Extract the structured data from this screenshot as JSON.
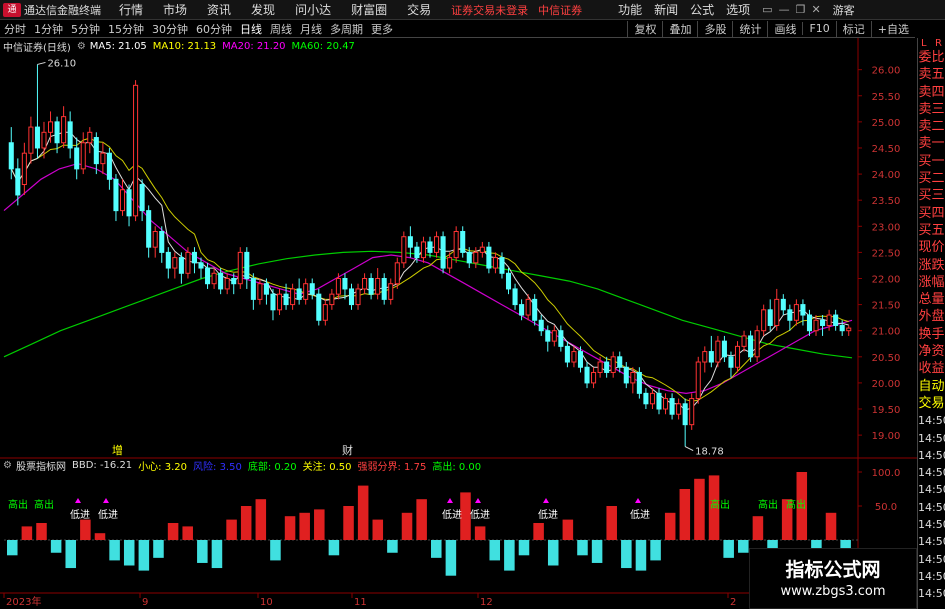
{
  "menubar": {
    "app_title": "通达信金融终端",
    "menus": [
      "行情",
      "市场",
      "资讯",
      "发现",
      "问小达",
      "财富圈",
      "交易"
    ],
    "warning": "证券交易未登录",
    "broker": "中信证券",
    "right_menus": [
      "功能",
      "新闻",
      "公式",
      "选项"
    ],
    "guest": "游客",
    "window_controls": [
      "▭",
      "—",
      "❐",
      "✕"
    ]
  },
  "tabbar": {
    "tabs": [
      "分时",
      "1分钟",
      "5分钟",
      "15分钟",
      "30分钟",
      "60分钟",
      "日线",
      "周线",
      "月线",
      "多周期",
      "更多"
    ],
    "active_tab": "日线",
    "tools": [
      "复权",
      "叠加",
      "多股",
      "统计",
      "画线",
      "F10",
      "标记",
      "+自选"
    ]
  },
  "info": {
    "stock": "中信证券(日线)",
    "ma5": "MA5: 21.05",
    "ma10": "MA10: 21.13",
    "ma20": "MA20: 21.20",
    "ma60": "MA60: 20.47",
    "colors": {
      "ma5": "#ffffff",
      "ma10": "#ffff00",
      "ma20": "#ff00ff",
      "ma60": "#00ff00"
    }
  },
  "price_axis": {
    "ticks": [
      "26.00",
      "25.50",
      "25.00",
      "24.50",
      "24.00",
      "23.50",
      "23.00",
      "22.50",
      "22.00",
      "21.50",
      "21.00",
      "20.50",
      "20.00",
      "19.50",
      "19.00"
    ],
    "max_label": "26.10",
    "min_label": "18.78"
  },
  "indicator": {
    "name": "股票指标网",
    "values": [
      {
        "text": "BBD: -16.21",
        "color": "#dddddd"
      },
      {
        "text": "小心: 3.20",
        "color": "#ffff00"
      },
      {
        "text": "风险: 3.50",
        "color": "#3030ff"
      },
      {
        "text": "底部: 0.20",
        "color": "#00ff00"
      },
      {
        "text": "关注: 0.50",
        "color": "#ffff00"
      },
      {
        "text": "强弱分界: 1.75",
        "color": "#ff4040"
      },
      {
        "text": "高出: 0.00",
        "color": "#00ff00"
      }
    ],
    "ticks": [
      "100.0",
      "50.0"
    ],
    "signals": {
      "low": "低进",
      "high": "高出"
    }
  },
  "date_axis": {
    "labels": [
      "2023年",
      "9",
      "10",
      "11",
      "12",
      "2"
    ]
  },
  "events": {
    "chip1": "增",
    "chip2": "财"
  },
  "side_panel": {
    "top": [
      "L",
      "R"
    ],
    "items": [
      "委比",
      "卖五",
      "卖四",
      "卖三",
      "卖二",
      "卖一",
      "买一",
      "买二",
      "买三",
      "买四",
      "买五",
      "现价",
      "涨跌",
      "涨幅",
      "总量",
      "外盘",
      "换手",
      "净资",
      "收益",
      "自动",
      "交易"
    ],
    "times": [
      "14:50",
      "14:50",
      "14:50",
      "14:50",
      "14:50",
      "14:50",
      "14:50",
      "14:50",
      "14:50",
      "14:50",
      "14:50"
    ]
  },
  "watermark": {
    "line1": "指标公式网",
    "line2": "www.zbgs3.com"
  },
  "chart_data": [
    {
      "type": "candlestick",
      "title": "中信证券(日线)",
      "ylim": [
        18.6,
        26.3
      ],
      "high_label": 26.1,
      "low_label": 18.78,
      "candles": [
        [
          24.6,
          24.1,
          24.9,
          23.9
        ],
        [
          24.1,
          23.6,
          24.3,
          23.4
        ],
        [
          23.8,
          24.4,
          24.6,
          23.6
        ],
        [
          24.4,
          24.9,
          25.1,
          24.2
        ],
        [
          24.9,
          24.5,
          26.1,
          24.3
        ],
        [
          24.5,
          24.8,
          25.0,
          24.3
        ],
        [
          24.8,
          25.0,
          25.2,
          24.6
        ],
        [
          25.0,
          24.6,
          25.1,
          24.4
        ],
        [
          24.6,
          25.1,
          25.3,
          24.5
        ],
        [
          25.0,
          24.5,
          25.2,
          24.3
        ],
        [
          24.5,
          24.1,
          24.7,
          23.9
        ],
        [
          24.1,
          24.6,
          24.8,
          24.0
        ],
        [
          24.6,
          24.8,
          24.9,
          24.4
        ],
        [
          24.7,
          24.2,
          24.8,
          24.0
        ],
        [
          24.2,
          24.4,
          24.6,
          24.0
        ],
        [
          24.4,
          23.9,
          24.5,
          23.7
        ],
        [
          23.9,
          23.3,
          24.0,
          23.1
        ],
        [
          23.3,
          23.7,
          23.9,
          23.2
        ],
        [
          23.7,
          23.2,
          23.8,
          23.0
        ],
        [
          23.2,
          25.7,
          25.8,
          23.1
        ],
        [
          23.8,
          23.3,
          23.9,
          23.1
        ],
        [
          23.3,
          22.6,
          23.4,
          22.4
        ],
        [
          22.6,
          22.9,
          23.0,
          22.4
        ],
        [
          22.9,
          22.5,
          23.0,
          22.3
        ],
        [
          22.5,
          22.2,
          22.6,
          22.0
        ],
        [
          22.2,
          22.4,
          22.5,
          22.0
        ],
        [
          22.4,
          22.1,
          22.5,
          21.9
        ],
        [
          22.1,
          22.5,
          22.6,
          22.0
        ],
        [
          22.5,
          22.3,
          22.6,
          22.1
        ],
        [
          22.3,
          22.2,
          22.4,
          22.0
        ],
        [
          22.2,
          21.9,
          22.3,
          21.8
        ],
        [
          21.9,
          22.1,
          22.2,
          21.8
        ],
        [
          22.1,
          21.8,
          22.2,
          21.7
        ],
        [
          21.8,
          22.0,
          22.1,
          21.7
        ],
        [
          22.0,
          21.9,
          22.1,
          21.7
        ],
        [
          21.9,
          22.5,
          22.6,
          21.8
        ],
        [
          22.5,
          22.0,
          22.6,
          21.8
        ],
        [
          22.0,
          21.6,
          22.1,
          21.4
        ],
        [
          21.6,
          21.9,
          22.0,
          21.5
        ],
        [
          21.9,
          21.7,
          22.0,
          21.5
        ],
        [
          21.7,
          21.4,
          21.8,
          21.2
        ],
        [
          21.4,
          21.7,
          21.8,
          21.3
        ],
        [
          21.7,
          21.5,
          21.9,
          21.4
        ],
        [
          21.5,
          21.8,
          21.9,
          21.4
        ],
        [
          21.8,
          21.6,
          22.0,
          21.5
        ],
        [
          21.6,
          21.9,
          22.0,
          21.5
        ],
        [
          21.9,
          21.7,
          22.0,
          21.6
        ],
        [
          21.7,
          21.2,
          21.8,
          21.1
        ],
        [
          21.2,
          21.5,
          21.6,
          21.1
        ],
        [
          21.5,
          21.7,
          21.8,
          21.4
        ],
        [
          21.7,
          22.0,
          22.1,
          21.6
        ],
        [
          22.0,
          21.8,
          22.1,
          21.6
        ],
        [
          21.8,
          21.5,
          21.9,
          21.4
        ],
        [
          21.5,
          21.8,
          21.9,
          21.4
        ],
        [
          21.8,
          22.0,
          22.1,
          21.7
        ],
        [
          22.0,
          21.7,
          22.1,
          21.6
        ],
        [
          21.7,
          22.0,
          22.2,
          21.6
        ],
        [
          22.0,
          21.6,
          22.1,
          21.5
        ],
        [
          21.6,
          21.9,
          22.0,
          21.5
        ],
        [
          21.9,
          22.3,
          22.4,
          21.8
        ],
        [
          22.3,
          22.8,
          22.9,
          22.2
        ],
        [
          22.8,
          22.6,
          23.0,
          22.4
        ],
        [
          22.6,
          22.4,
          22.7,
          22.3
        ],
        [
          22.4,
          22.7,
          22.8,
          22.3
        ],
        [
          22.7,
          22.5,
          22.8,
          22.4
        ],
        [
          22.5,
          22.8,
          22.9,
          22.4
        ],
        [
          22.8,
          22.2,
          22.9,
          22.1
        ],
        [
          22.2,
          22.4,
          22.5,
          22.1
        ],
        [
          22.4,
          22.9,
          23.0,
          22.3
        ],
        [
          22.9,
          22.5,
          23.0,
          22.4
        ],
        [
          22.5,
          22.3,
          22.6,
          22.2
        ],
        [
          22.3,
          22.5,
          22.6,
          22.2
        ],
        [
          22.5,
          22.6,
          22.7,
          22.4
        ],
        [
          22.6,
          22.2,
          22.7,
          22.1
        ],
        [
          22.2,
          22.4,
          22.5,
          22.1
        ],
        [
          22.4,
          22.1,
          22.5,
          22.0
        ],
        [
          22.1,
          21.8,
          22.2,
          21.7
        ],
        [
          21.8,
          21.5,
          21.9,
          21.4
        ],
        [
          21.5,
          21.3,
          21.6,
          21.2
        ],
        [
          21.3,
          21.6,
          21.7,
          21.2
        ],
        [
          21.6,
          21.2,
          21.7,
          21.1
        ],
        [
          21.2,
          21.0,
          21.3,
          20.9
        ],
        [
          21.0,
          20.8,
          21.1,
          20.6
        ],
        [
          20.8,
          21.0,
          21.1,
          20.7
        ],
        [
          21.0,
          20.7,
          21.1,
          20.6
        ],
        [
          20.7,
          20.4,
          20.8,
          20.3
        ],
        [
          20.4,
          20.6,
          20.7,
          20.3
        ],
        [
          20.6,
          20.3,
          20.7,
          20.2
        ],
        [
          20.3,
          20.0,
          20.4,
          19.9
        ],
        [
          20.0,
          20.2,
          20.3,
          19.9
        ],
        [
          20.2,
          20.4,
          20.5,
          20.1
        ],
        [
          20.4,
          20.2,
          20.5,
          20.1
        ],
        [
          20.2,
          20.5,
          20.6,
          20.1
        ],
        [
          20.5,
          20.3,
          20.6,
          20.2
        ],
        [
          20.3,
          20.0,
          20.4,
          19.9
        ],
        [
          20.0,
          20.2,
          20.3,
          19.8
        ],
        [
          20.2,
          19.8,
          20.3,
          19.7
        ],
        [
          19.8,
          19.6,
          19.9,
          19.5
        ],
        [
          19.6,
          19.8,
          19.9,
          19.5
        ],
        [
          19.8,
          19.5,
          19.9,
          19.4
        ],
        [
          19.5,
          19.7,
          19.8,
          19.4
        ],
        [
          19.7,
          19.4,
          19.8,
          19.3
        ],
        [
          19.4,
          19.6,
          19.7,
          19.3
        ],
        [
          19.6,
          19.2,
          19.7,
          18.78
        ],
        [
          19.2,
          19.7,
          19.8,
          19.1
        ],
        [
          19.7,
          20.4,
          20.5,
          19.6
        ],
        [
          20.4,
          20.6,
          20.7,
          20.2
        ],
        [
          20.6,
          20.4,
          20.9,
          20.3
        ],
        [
          20.4,
          20.8,
          20.9,
          20.3
        ],
        [
          20.8,
          20.5,
          20.9,
          20.4
        ],
        [
          20.5,
          20.3,
          20.6,
          20.1
        ],
        [
          20.3,
          20.7,
          20.8,
          20.2
        ],
        [
          20.7,
          20.9,
          21.0,
          20.6
        ],
        [
          20.9,
          20.5,
          21.0,
          20.4
        ],
        [
          20.5,
          21.0,
          21.1,
          20.4
        ],
        [
          21.0,
          21.4,
          21.5,
          20.9
        ],
        [
          21.4,
          21.1,
          21.6,
          21.0
        ],
        [
          21.1,
          21.6,
          21.8,
          21.0
        ],
        [
          21.6,
          21.4,
          21.7,
          21.3
        ],
        [
          21.4,
          21.2,
          21.5,
          21.0
        ],
        [
          21.2,
          21.5,
          21.6,
          21.1
        ],
        [
          21.5,
          21.3,
          21.6,
          21.1
        ],
        [
          21.3,
          21.0,
          21.4,
          20.9
        ],
        [
          21.0,
          21.2,
          21.3,
          20.9
        ],
        [
          21.2,
          21.1,
          21.3,
          20.9
        ],
        [
          21.1,
          21.3,
          21.4,
          21.0
        ],
        [
          21.3,
          21.1,
          21.4,
          21.0
        ],
        [
          21.1,
          21.0,
          21.2,
          20.9
        ],
        [
          21.0,
          21.05,
          21.1,
          20.9
        ]
      ],
      "ma60": [
        20.5,
        20.75,
        21.0,
        21.2,
        21.4,
        21.6,
        21.8,
        22.0,
        22.15,
        22.28,
        22.38,
        22.45,
        22.5,
        22.52,
        22.5,
        22.45,
        22.35,
        22.25,
        22.15,
        22.05,
        21.95,
        21.8,
        21.6,
        21.4,
        21.2,
        21.05,
        20.9,
        20.75,
        20.65,
        20.55,
        20.48
      ],
      "ma20": [
        23.3,
        23.6,
        23.9,
        24.1,
        24.2,
        24.1,
        23.9,
        23.5,
        23.1,
        22.8,
        22.5,
        22.3,
        22.1,
        22.0,
        21.9,
        21.8,
        21.7,
        21.8,
        22.0,
        22.2,
        22.4,
        22.45,
        22.4,
        22.3,
        22.1,
        21.9,
        21.7,
        21.5,
        21.3,
        21.1,
        20.9,
        20.7,
        20.5,
        20.3,
        20.1,
        19.95,
        19.85,
        19.8,
        19.85,
        20.0,
        20.2,
        20.4,
        20.6,
        20.8,
        21.0,
        21.1,
        21.2
      ],
      "indicator_bars": [
        -30,
        20,
        25,
        -25,
        -55,
        30,
        10,
        -40,
        -50,
        -60,
        -35,
        25,
        20,
        -45,
        -55,
        30,
        50,
        60,
        -40,
        35,
        40,
        45,
        -30,
        50,
        80,
        30,
        -25,
        40,
        60,
        -35,
        -70,
        70,
        20,
        -40,
        -60,
        -30,
        25,
        -50,
        30,
        -30,
        -45,
        50,
        -55,
        -60,
        -40,
        40,
        75,
        90,
        95,
        -35,
        -25,
        35,
        -20,
        60,
        100,
        -40,
        40,
        -50
      ]
    }
  ]
}
